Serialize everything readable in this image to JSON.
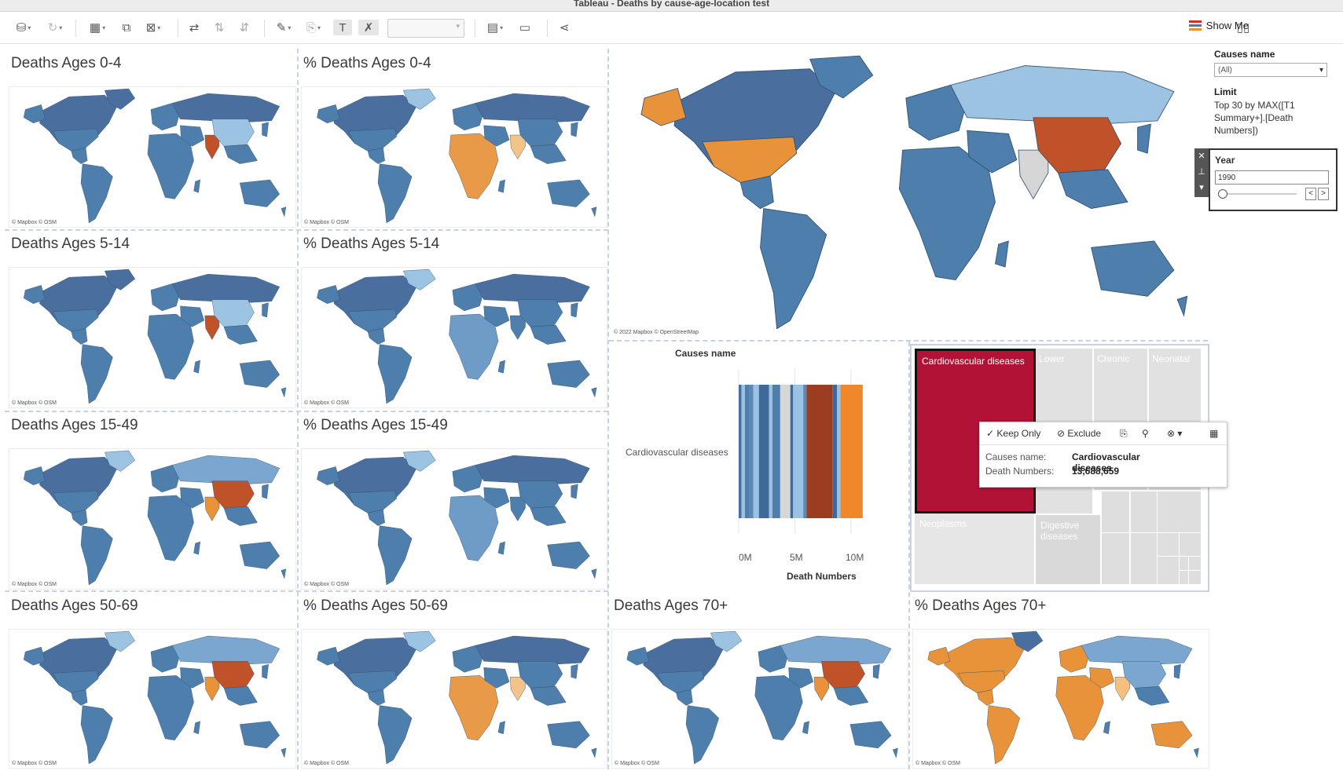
{
  "window": {
    "title": "Tableau - Deaths by cause-age-location test"
  },
  "toolbar": {
    "show_me": "Show Me"
  },
  "panels": {
    "p1": {
      "title": "Deaths Ages 0-4",
      "credit": "© Mapbox © OSM"
    },
    "p2": {
      "title": "% Deaths Ages 0-4",
      "credit": "© Mapbox © OSM"
    },
    "p3": {
      "title": "Deaths Ages 5-14",
      "credit": "© Mapbox © OSM"
    },
    "p4": {
      "title": "% Deaths Ages 5-14",
      "credit": "© Mapbox © OSM"
    },
    "p5": {
      "title": "Deaths Ages 15-49",
      "credit": "© Mapbox © OSM"
    },
    "p6": {
      "title": "% Deaths Ages 15-49",
      "credit": "© Mapbox © OSM"
    },
    "p7": {
      "title": "Deaths Ages 50-69",
      "credit": "© Mapbox © OSM"
    },
    "p8": {
      "title": "% Deaths Ages 50-69",
      "credit": "© Mapbox © OSM"
    },
    "p9": {
      "title": "Deaths Ages 70+",
      "credit": "© Mapbox © OSM"
    },
    "p10": {
      "title": "% Deaths Ages 70+",
      "credit": "© Mapbox © OSM"
    },
    "big": {
      "credit": "© 2022 Mapbox © OpenStreetMap"
    }
  },
  "filters": {
    "causes_label": "Causes name",
    "causes_value": "(All)",
    "limit_label": "Limit",
    "limit_text": "Top 30 by MAX([T1 Summary+].[Death Numbers])",
    "year_label": "Year",
    "year_value": "1990"
  },
  "colors": {
    "accent_red": "#b31237",
    "orange": "#e8923a",
    "dark_orange": "#c0522a",
    "blue": "#4e7eab",
    "light_blue": "#9dc3e3"
  },
  "chart_data": {
    "type": "bar",
    "title": "Causes name",
    "categories": [
      "Cardiovascular diseases"
    ],
    "total": 13688659,
    "xlabel": "Death Numbers",
    "x_ticks": [
      "0M",
      "5M",
      "10M"
    ],
    "xlim": [
      0,
      14000000
    ],
    "segments": [
      {
        "value": 250000,
        "color": "#4a6f9e"
      },
      {
        "value": 300000,
        "color": "#9bc2e2"
      },
      {
        "value": 400000,
        "color": "#4e7eab"
      },
      {
        "value": 350000,
        "color": "#5a88b8"
      },
      {
        "value": 500000,
        "color": "#9bc2e2"
      },
      {
        "value": 900000,
        "color": "#3d6a9a"
      },
      {
        "value": 300000,
        "color": "#9bc2e2"
      },
      {
        "value": 700000,
        "color": "#4e7eab"
      },
      {
        "value": 900000,
        "color": "#d6d6d6"
      },
      {
        "value": 250000,
        "color": "#3d6a9a"
      },
      {
        "value": 900000,
        "color": "#9bc2e2"
      },
      {
        "value": 300000,
        "color": "#5a88b8"
      },
      {
        "value": 2300000,
        "color": "#9a3e1f"
      },
      {
        "value": 400000,
        "color": "#3d6a9a"
      },
      {
        "value": 300000,
        "color": "#9bc2e2"
      },
      {
        "value": 2000000,
        "color": "#f0882b"
      }
    ]
  },
  "treemap": {
    "items": [
      "Cardiovascular diseases",
      "Lower",
      "Chronic",
      "Neonatal",
      "Neoplasms",
      "Digestive diseases"
    ]
  },
  "tooltip": {
    "keep_only": "Keep Only",
    "exclude": "Exclude",
    "label1": "Causes name:",
    "value1": "Cardiovascular diseases",
    "label2": "Death Numbers:",
    "value2": "13,688,659"
  }
}
